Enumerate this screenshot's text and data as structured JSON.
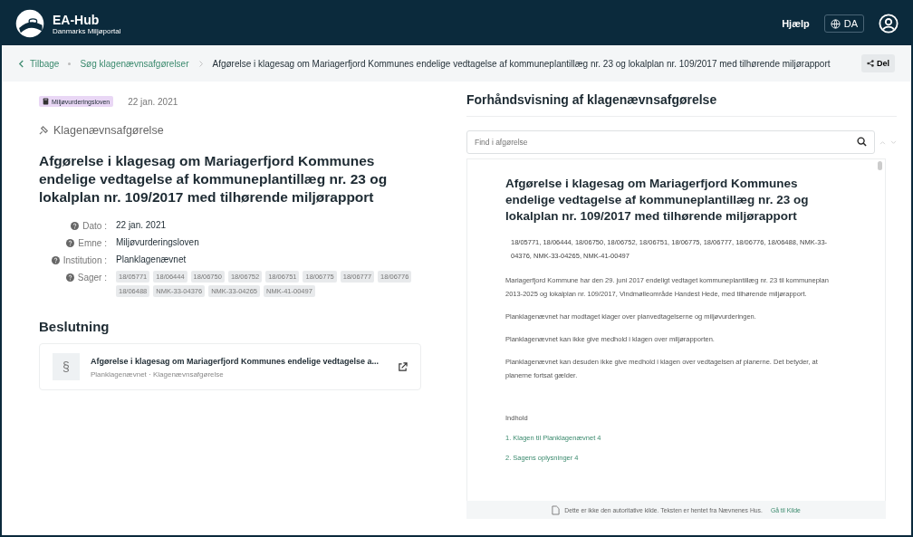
{
  "header": {
    "brand": "EA-Hub",
    "subtitle": "Danmarks Miljøportal",
    "help": "Hjælp",
    "language": "DA"
  },
  "breadcrumb": {
    "back": "Tilbage",
    "items": [
      {
        "label": "Søg klagenævnsafgørelser",
        "kind": "link"
      },
      {
        "label": "Afgørelse i klagesag om Mariagerfjord Kommunes endelige vedtagelse af kommuneplantillæg nr. 23 og lokalplan nr. 109/2017 med tilhørende miljørapport",
        "kind": "current"
      }
    ],
    "share": "Del"
  },
  "detail": {
    "tag": "Miljøvurderingsloven",
    "date": "22 jan. 2021",
    "type": "Klagenævnsafgørelse",
    "title": "Afgørelse i klagesag om Mariagerfjord Kommunes endelige vedtagelse af kommuneplantillæg nr. 23 og lokalplan nr. 109/2017 med tilhørende miljørapport",
    "fields": [
      {
        "label": "Dato :",
        "value": "22 jan. 2021"
      },
      {
        "label": "Emne :",
        "value": "Miljøvurderingsloven"
      },
      {
        "label": "Institution :",
        "value": "Planklagenævnet"
      }
    ],
    "cases_label": "Sager :",
    "cases": [
      "18/05771",
      "18/06444",
      "18/06750",
      "18/06752",
      "18/06751",
      "18/06775",
      "18/06777",
      "18/06776",
      "18/06488",
      "NMK-33-04376",
      "NMK-33-04265",
      "NMK-41-00497"
    ]
  },
  "decision": {
    "heading": "Beslutning",
    "symbol": "§",
    "title": "Afgørelse i klagesag om Mariagerfjord Kommunes endelige vedtagelse a...",
    "meta": "Planklagenævnet · Klagenævnsafgørelse"
  },
  "preview": {
    "heading": "Forhåndsvisning af klagenævnsafgørelse",
    "search": {
      "placeholder": "Find i afgørelse"
    },
    "doc_title": "Afgørelse i klagesag om Mariagerfjord Kommunes endelige vedtagelse af kommuneplantillæg nr. 23 og lokalplan nr. 109/2017 med tilhørende miljørapport",
    "doc_cases": "18/05771, 18/06444, 18/06750, 18/06752, 18/06751, 18/06775, 18/06777, 18/06776, 18/06488, NMK-33-04376, NMK-33-04265, NMK-41-00497",
    "paragraphs": [
      "Mariagerfjord Kommune har den 29. juni 2017 endeligt vedtaget kommuneplantillæg nr. 23 til kommuneplan 2013-2025 og lokalplan nr. 109/2017, Vindmølleområde Handest Hede, med tilhørende miljørapport.",
      "Planklagenævnet har modtaget klager over planvedtagelserne og miljøvurderingen.",
      "Planklagenævnet kan ikke give medhold i klagen over miljørapporten.",
      "Planklagenævnet kan desuden ikke give medhold i klagen over vedtagelsen af planerne. Det betyder, at planerne fortsat gælder."
    ],
    "toc_heading": "Indhold",
    "toc": [
      "1. Klagen til Planklagenævnet 4",
      "2. Sagens oplysninger 4"
    ],
    "footer": "Dette er ikke den autoritative kilde. Teksten er hentet fra Nævnenes Hus.",
    "footer_link": "Gå til Kilde"
  }
}
